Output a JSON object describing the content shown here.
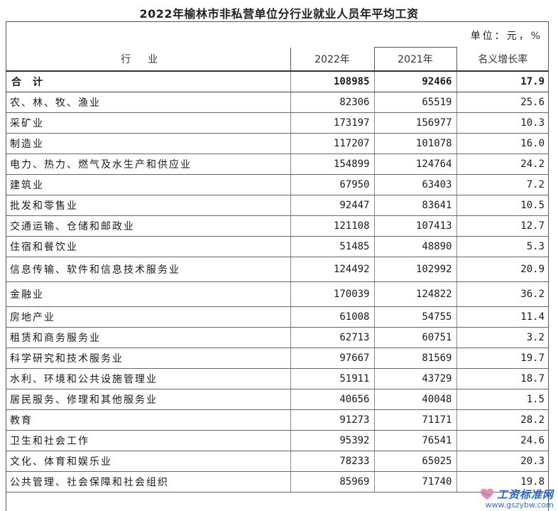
{
  "title": "2022年榆林市非私营单位分行业就业人员年平均工资",
  "unit_note": "单位：元，%",
  "columns": {
    "industry": "行业",
    "y2022": "2022年",
    "y2021": "2021年",
    "growth": "名义增长率"
  },
  "rows": [
    {
      "name": "合计",
      "y2022": "108985",
      "y2021": "92466",
      "growth": "17.9"
    },
    {
      "name": "农、林、牧、渔业",
      "y2022": "82306",
      "y2021": "65519",
      "growth": "25.6"
    },
    {
      "name": "采矿业",
      "y2022": "173197",
      "y2021": "156977",
      "growth": "10.3"
    },
    {
      "name": "制造业",
      "y2022": "117207",
      "y2021": "101078",
      "growth": "16.0"
    },
    {
      "name": "电力、热力、燃气及水生产和供应业",
      "y2022": "154899",
      "y2021": "124764",
      "growth": "24.2"
    },
    {
      "name": "建筑业",
      "y2022": "67950",
      "y2021": "63403",
      "growth": "7.2"
    },
    {
      "name": "批发和零售业",
      "y2022": "92447",
      "y2021": "83641",
      "growth": "10.5"
    },
    {
      "name": "交通运输、仓储和邮政业",
      "y2022": "121108",
      "y2021": "107413",
      "growth": "12.7"
    },
    {
      "name": "住宿和餐饮业",
      "y2022": "51485",
      "y2021": "48890",
      "growth": "5.3"
    },
    {
      "name": "信息传输、软件和信息技术服务业",
      "y2022": "124492",
      "y2021": "102992",
      "growth": "20.9"
    },
    {
      "name": "金融业",
      "y2022": "170039",
      "y2021": "124822",
      "growth": "36.2"
    },
    {
      "name": "房地产业",
      "y2022": "61008",
      "y2021": "54755",
      "growth": "11.4"
    },
    {
      "name": "租赁和商务服务业",
      "y2022": "62713",
      "y2021": "60751",
      "growth": "3.2"
    },
    {
      "name": "科学研究和技术服务业",
      "y2022": "97667",
      "y2021": "81569",
      "growth": "19.7"
    },
    {
      "name": "水利、环境和公共设施管理业",
      "y2022": "51911",
      "y2021": "43729",
      "growth": "18.7"
    },
    {
      "name": "居民服务、修理和其他服务业",
      "y2022": "40656",
      "y2021": "40048",
      "growth": "1.5"
    },
    {
      "name": "教育",
      "y2022": "91273",
      "y2021": "71171",
      "growth": "28.2"
    },
    {
      "name": "卫生和社会工作",
      "y2022": "95392",
      "y2021": "76541",
      "growth": "24.6"
    },
    {
      "name": "文化、体育和娱乐业",
      "y2022": "78233",
      "y2021": "65025",
      "growth": "20.3"
    },
    {
      "name": "公共管理、社会保障和社会组织",
      "y2022": "85969",
      "y2021": "71740",
      "growth": "19.8"
    }
  ],
  "watermark": {
    "title": "工资标准网",
    "url": "www.gszybw.com",
    "logo_icon": "heart-logo-icon",
    "logo_color": "#e8739a"
  }
}
